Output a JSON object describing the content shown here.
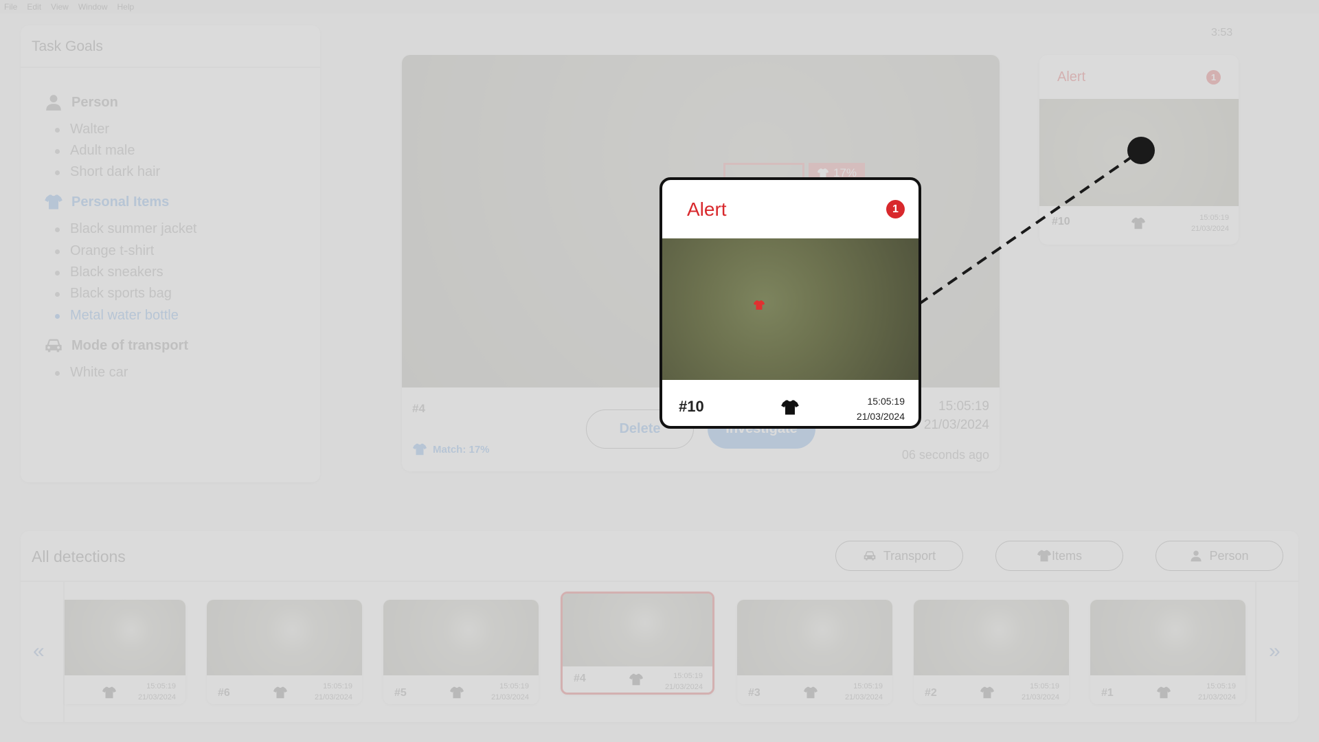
{
  "menubar": {
    "items": [
      "File",
      "Edit",
      "View",
      "Window",
      "Help"
    ]
  },
  "clock": "3:53",
  "task_goals": {
    "title": "Task Goals",
    "person": {
      "label": "Person",
      "items": [
        "Walter",
        "Adult male",
        "Short dark hair"
      ]
    },
    "personal_items": {
      "label": "Personal Items",
      "items": [
        "Black summer jacket",
        "Orange t-shirt",
        "Black sneakers",
        "Black sports bag",
        "Metal water bottle"
      ]
    },
    "transport": {
      "label": "Mode of transport",
      "items": [
        "White car"
      ]
    }
  },
  "main_detection": {
    "id": "#4",
    "bbox_label": "17%",
    "time": "15:05:19",
    "date": "21/03/2024",
    "ago": "06 seconds ago",
    "match": "Match: 17%",
    "delete_label": "Delete",
    "investigate_label": "Investigate"
  },
  "side_alert": {
    "title": "Alert",
    "badge": "1",
    "id": "#10",
    "time": "15:05:19",
    "date": "21/03/2024",
    "icon": "tshirt-icon"
  },
  "popup_alert": {
    "title": "Alert",
    "badge": "1",
    "id": "#10",
    "time": "15:05:19",
    "date": "21/03/2024",
    "icon": "tshirt-icon"
  },
  "detections": {
    "title": "All detections",
    "filters": {
      "transport": "Transport",
      "items": "Items",
      "person": "Person"
    },
    "cards": [
      {
        "id": "",
        "time": "15:05:19",
        "date": "21/03/2024"
      },
      {
        "id": "#6",
        "time": "15:05:19",
        "date": "21/03/2024"
      },
      {
        "id": "#5",
        "time": "15:05:19",
        "date": "21/03/2024"
      },
      {
        "id": "#4",
        "time": "15:05:19",
        "date": "21/03/2024"
      },
      {
        "id": "#3",
        "time": "15:05:19",
        "date": "21/03/2024"
      },
      {
        "id": "#2",
        "time": "15:05:19",
        "date": "21/03/2024"
      },
      {
        "id": "#1",
        "time": "15:05:19",
        "date": "21/03/2024"
      }
    ],
    "prev_arrow": "«",
    "next_arrow": "»"
  },
  "colors": {
    "alert_red": "#d8282c",
    "accent_blue": "#4a90e2",
    "overlay": "#d2d2d2"
  }
}
